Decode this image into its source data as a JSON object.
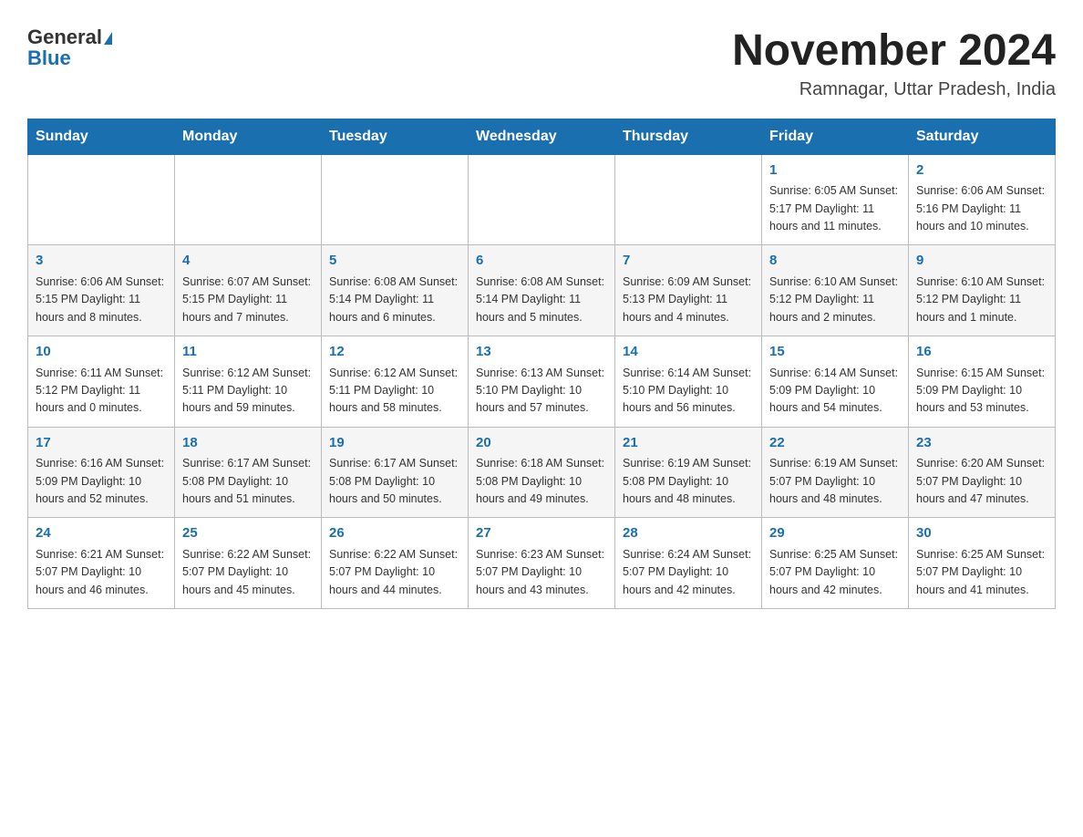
{
  "header": {
    "logo_general": "General",
    "logo_blue": "Blue",
    "month_title": "November 2024",
    "location": "Ramnagar, Uttar Pradesh, India"
  },
  "days_of_week": [
    "Sunday",
    "Monday",
    "Tuesday",
    "Wednesday",
    "Thursday",
    "Friday",
    "Saturday"
  ],
  "weeks": [
    [
      {
        "day": "",
        "info": ""
      },
      {
        "day": "",
        "info": ""
      },
      {
        "day": "",
        "info": ""
      },
      {
        "day": "",
        "info": ""
      },
      {
        "day": "",
        "info": ""
      },
      {
        "day": "1",
        "info": "Sunrise: 6:05 AM\nSunset: 5:17 PM\nDaylight: 11 hours\nand 11 minutes."
      },
      {
        "day": "2",
        "info": "Sunrise: 6:06 AM\nSunset: 5:16 PM\nDaylight: 11 hours\nand 10 minutes."
      }
    ],
    [
      {
        "day": "3",
        "info": "Sunrise: 6:06 AM\nSunset: 5:15 PM\nDaylight: 11 hours\nand 8 minutes."
      },
      {
        "day": "4",
        "info": "Sunrise: 6:07 AM\nSunset: 5:15 PM\nDaylight: 11 hours\nand 7 minutes."
      },
      {
        "day": "5",
        "info": "Sunrise: 6:08 AM\nSunset: 5:14 PM\nDaylight: 11 hours\nand 6 minutes."
      },
      {
        "day": "6",
        "info": "Sunrise: 6:08 AM\nSunset: 5:14 PM\nDaylight: 11 hours\nand 5 minutes."
      },
      {
        "day": "7",
        "info": "Sunrise: 6:09 AM\nSunset: 5:13 PM\nDaylight: 11 hours\nand 4 minutes."
      },
      {
        "day": "8",
        "info": "Sunrise: 6:10 AM\nSunset: 5:12 PM\nDaylight: 11 hours\nand 2 minutes."
      },
      {
        "day": "9",
        "info": "Sunrise: 6:10 AM\nSunset: 5:12 PM\nDaylight: 11 hours\nand 1 minute."
      }
    ],
    [
      {
        "day": "10",
        "info": "Sunrise: 6:11 AM\nSunset: 5:12 PM\nDaylight: 11 hours\nand 0 minutes."
      },
      {
        "day": "11",
        "info": "Sunrise: 6:12 AM\nSunset: 5:11 PM\nDaylight: 10 hours\nand 59 minutes."
      },
      {
        "day": "12",
        "info": "Sunrise: 6:12 AM\nSunset: 5:11 PM\nDaylight: 10 hours\nand 58 minutes."
      },
      {
        "day": "13",
        "info": "Sunrise: 6:13 AM\nSunset: 5:10 PM\nDaylight: 10 hours\nand 57 minutes."
      },
      {
        "day": "14",
        "info": "Sunrise: 6:14 AM\nSunset: 5:10 PM\nDaylight: 10 hours\nand 56 minutes."
      },
      {
        "day": "15",
        "info": "Sunrise: 6:14 AM\nSunset: 5:09 PM\nDaylight: 10 hours\nand 54 minutes."
      },
      {
        "day": "16",
        "info": "Sunrise: 6:15 AM\nSunset: 5:09 PM\nDaylight: 10 hours\nand 53 minutes."
      }
    ],
    [
      {
        "day": "17",
        "info": "Sunrise: 6:16 AM\nSunset: 5:09 PM\nDaylight: 10 hours\nand 52 minutes."
      },
      {
        "day": "18",
        "info": "Sunrise: 6:17 AM\nSunset: 5:08 PM\nDaylight: 10 hours\nand 51 minutes."
      },
      {
        "day": "19",
        "info": "Sunrise: 6:17 AM\nSunset: 5:08 PM\nDaylight: 10 hours\nand 50 minutes."
      },
      {
        "day": "20",
        "info": "Sunrise: 6:18 AM\nSunset: 5:08 PM\nDaylight: 10 hours\nand 49 minutes."
      },
      {
        "day": "21",
        "info": "Sunrise: 6:19 AM\nSunset: 5:08 PM\nDaylight: 10 hours\nand 48 minutes."
      },
      {
        "day": "22",
        "info": "Sunrise: 6:19 AM\nSunset: 5:07 PM\nDaylight: 10 hours\nand 48 minutes."
      },
      {
        "day": "23",
        "info": "Sunrise: 6:20 AM\nSunset: 5:07 PM\nDaylight: 10 hours\nand 47 minutes."
      }
    ],
    [
      {
        "day": "24",
        "info": "Sunrise: 6:21 AM\nSunset: 5:07 PM\nDaylight: 10 hours\nand 46 minutes."
      },
      {
        "day": "25",
        "info": "Sunrise: 6:22 AM\nSunset: 5:07 PM\nDaylight: 10 hours\nand 45 minutes."
      },
      {
        "day": "26",
        "info": "Sunrise: 6:22 AM\nSunset: 5:07 PM\nDaylight: 10 hours\nand 44 minutes."
      },
      {
        "day": "27",
        "info": "Sunrise: 6:23 AM\nSunset: 5:07 PM\nDaylight: 10 hours\nand 43 minutes."
      },
      {
        "day": "28",
        "info": "Sunrise: 6:24 AM\nSunset: 5:07 PM\nDaylight: 10 hours\nand 42 minutes."
      },
      {
        "day": "29",
        "info": "Sunrise: 6:25 AM\nSunset: 5:07 PM\nDaylight: 10 hours\nand 42 minutes."
      },
      {
        "day": "30",
        "info": "Sunrise: 6:25 AM\nSunset: 5:07 PM\nDaylight: 10 hours\nand 41 minutes."
      }
    ]
  ]
}
